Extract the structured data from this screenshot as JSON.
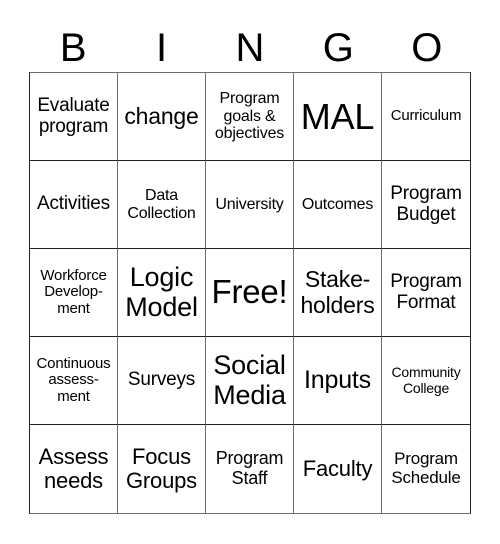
{
  "header": {
    "letters": [
      "B",
      "I",
      "N",
      "G",
      "O"
    ]
  },
  "card": {
    "rows": [
      [
        "Evaluate\nprogram",
        "change",
        "Program\ngoals &\nobjectives",
        "MAL",
        "Curriculum"
      ],
      [
        "Activities",
        "Data\nCollection",
        "University",
        "Outcomes",
        "Program\nBudget"
      ],
      [
        "Workforce\nDevelop-\nment",
        "Logic\nModel",
        "Free!",
        "Stake-\nholders",
        "Program\nFormat"
      ],
      [
        "Continuous\nassess-\nment",
        "Surveys",
        "Social\nMedia",
        "Inputs",
        "Community\nCollege"
      ],
      [
        "Assess\nneeds",
        "Focus\nGroups",
        "Program\nStaff",
        "Faculty",
        "Program\nSchedule"
      ]
    ]
  }
}
